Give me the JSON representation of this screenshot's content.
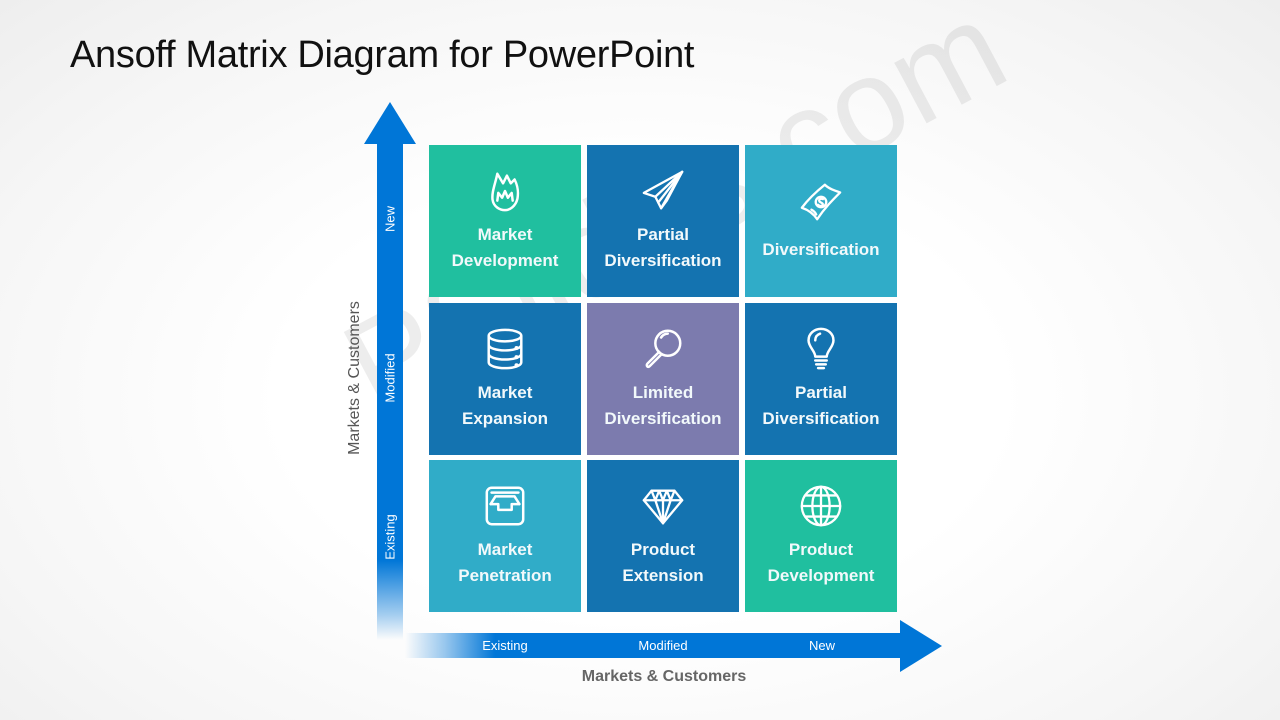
{
  "title": "Ansoff Matrix Diagram for PowerPoint",
  "watermark": "PSlides.com",
  "colors": {
    "arrow": "#0076d7",
    "teal": "#20bf9f",
    "dark_blue": "#1473b0",
    "cyan": "#30acc8",
    "purple": "#7c7bae"
  },
  "y_axis": {
    "title": "Markets & Customers",
    "labels": [
      "Existing",
      "Modified",
      "New"
    ]
  },
  "x_axis": {
    "title": "Markets & Customers",
    "labels": [
      "Existing",
      "Modified",
      "New"
    ]
  },
  "cells": [
    {
      "line1": "Market",
      "line2": "Development",
      "icon": "flame-icon",
      "color": "#20bf9f",
      "row": "New",
      "col": "Existing"
    },
    {
      "line1": "Partial",
      "line2": "Diversification",
      "icon": "paper-plane-icon",
      "color": "#1473b0",
      "row": "New",
      "col": "Modified"
    },
    {
      "line1": "Diversification",
      "line2": "",
      "icon": "money-bill-icon",
      "color": "#30acc8",
      "row": "New",
      "col": "New"
    },
    {
      "line1": "Market",
      "line2": "Expansion",
      "icon": "database-icon",
      "color": "#1473b0",
      "row": "Modified",
      "col": "Existing"
    },
    {
      "line1": "Limited",
      "line2": "Diversification",
      "icon": "magnifier-icon",
      "color": "#7c7bae",
      "row": "Modified",
      "col": "Modified"
    },
    {
      "line1": "Partial",
      "line2": "Diversification",
      "icon": "lightbulb-icon",
      "color": "#1473b0",
      "row": "Modified",
      "col": "New"
    },
    {
      "line1": "Market",
      "line2": "Penetration",
      "icon": "inbox-tray-icon",
      "color": "#30acc8",
      "row": "Existing",
      "col": "Existing"
    },
    {
      "line1": "Product",
      "line2": "Extension",
      "icon": "diamond-icon",
      "color": "#1473b0",
      "row": "Existing",
      "col": "Modified"
    },
    {
      "line1": "Product",
      "line2": "Development",
      "icon": "globe-icon",
      "color": "#20bf9f",
      "row": "Existing",
      "col": "New"
    }
  ]
}
